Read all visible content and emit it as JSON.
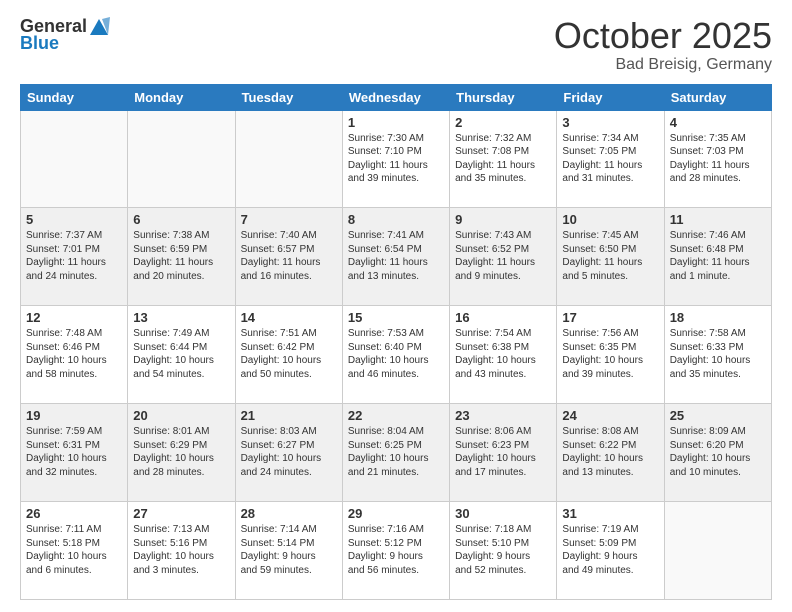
{
  "header": {
    "logo_general": "General",
    "logo_blue": "Blue",
    "month": "October 2025",
    "location": "Bad Breisig, Germany"
  },
  "days_of_week": [
    "Sunday",
    "Monday",
    "Tuesday",
    "Wednesday",
    "Thursday",
    "Friday",
    "Saturday"
  ],
  "weeks": [
    [
      {
        "day": "",
        "info": ""
      },
      {
        "day": "",
        "info": ""
      },
      {
        "day": "",
        "info": ""
      },
      {
        "day": "1",
        "info": "Sunrise: 7:30 AM\nSunset: 7:10 PM\nDaylight: 11 hours\nand 39 minutes."
      },
      {
        "day": "2",
        "info": "Sunrise: 7:32 AM\nSunset: 7:08 PM\nDaylight: 11 hours\nand 35 minutes."
      },
      {
        "day": "3",
        "info": "Sunrise: 7:34 AM\nSunset: 7:05 PM\nDaylight: 11 hours\nand 31 minutes."
      },
      {
        "day": "4",
        "info": "Sunrise: 7:35 AM\nSunset: 7:03 PM\nDaylight: 11 hours\nand 28 minutes."
      }
    ],
    [
      {
        "day": "5",
        "info": "Sunrise: 7:37 AM\nSunset: 7:01 PM\nDaylight: 11 hours\nand 24 minutes."
      },
      {
        "day": "6",
        "info": "Sunrise: 7:38 AM\nSunset: 6:59 PM\nDaylight: 11 hours\nand 20 minutes."
      },
      {
        "day": "7",
        "info": "Sunrise: 7:40 AM\nSunset: 6:57 PM\nDaylight: 11 hours\nand 16 minutes."
      },
      {
        "day": "8",
        "info": "Sunrise: 7:41 AM\nSunset: 6:54 PM\nDaylight: 11 hours\nand 13 minutes."
      },
      {
        "day": "9",
        "info": "Sunrise: 7:43 AM\nSunset: 6:52 PM\nDaylight: 11 hours\nand 9 minutes."
      },
      {
        "day": "10",
        "info": "Sunrise: 7:45 AM\nSunset: 6:50 PM\nDaylight: 11 hours\nand 5 minutes."
      },
      {
        "day": "11",
        "info": "Sunrise: 7:46 AM\nSunset: 6:48 PM\nDaylight: 11 hours\nand 1 minute."
      }
    ],
    [
      {
        "day": "12",
        "info": "Sunrise: 7:48 AM\nSunset: 6:46 PM\nDaylight: 10 hours\nand 58 minutes."
      },
      {
        "day": "13",
        "info": "Sunrise: 7:49 AM\nSunset: 6:44 PM\nDaylight: 10 hours\nand 54 minutes."
      },
      {
        "day": "14",
        "info": "Sunrise: 7:51 AM\nSunset: 6:42 PM\nDaylight: 10 hours\nand 50 minutes."
      },
      {
        "day": "15",
        "info": "Sunrise: 7:53 AM\nSunset: 6:40 PM\nDaylight: 10 hours\nand 46 minutes."
      },
      {
        "day": "16",
        "info": "Sunrise: 7:54 AM\nSunset: 6:38 PM\nDaylight: 10 hours\nand 43 minutes."
      },
      {
        "day": "17",
        "info": "Sunrise: 7:56 AM\nSunset: 6:35 PM\nDaylight: 10 hours\nand 39 minutes."
      },
      {
        "day": "18",
        "info": "Sunrise: 7:58 AM\nSunset: 6:33 PM\nDaylight: 10 hours\nand 35 minutes."
      }
    ],
    [
      {
        "day": "19",
        "info": "Sunrise: 7:59 AM\nSunset: 6:31 PM\nDaylight: 10 hours\nand 32 minutes."
      },
      {
        "day": "20",
        "info": "Sunrise: 8:01 AM\nSunset: 6:29 PM\nDaylight: 10 hours\nand 28 minutes."
      },
      {
        "day": "21",
        "info": "Sunrise: 8:03 AM\nSunset: 6:27 PM\nDaylight: 10 hours\nand 24 minutes."
      },
      {
        "day": "22",
        "info": "Sunrise: 8:04 AM\nSunset: 6:25 PM\nDaylight: 10 hours\nand 21 minutes."
      },
      {
        "day": "23",
        "info": "Sunrise: 8:06 AM\nSunset: 6:23 PM\nDaylight: 10 hours\nand 17 minutes."
      },
      {
        "day": "24",
        "info": "Sunrise: 8:08 AM\nSunset: 6:22 PM\nDaylight: 10 hours\nand 13 minutes."
      },
      {
        "day": "25",
        "info": "Sunrise: 8:09 AM\nSunset: 6:20 PM\nDaylight: 10 hours\nand 10 minutes."
      }
    ],
    [
      {
        "day": "26",
        "info": "Sunrise: 7:11 AM\nSunset: 5:18 PM\nDaylight: 10 hours\nand 6 minutes."
      },
      {
        "day": "27",
        "info": "Sunrise: 7:13 AM\nSunset: 5:16 PM\nDaylight: 10 hours\nand 3 minutes."
      },
      {
        "day": "28",
        "info": "Sunrise: 7:14 AM\nSunset: 5:14 PM\nDaylight: 9 hours\nand 59 minutes."
      },
      {
        "day": "29",
        "info": "Sunrise: 7:16 AM\nSunset: 5:12 PM\nDaylight: 9 hours\nand 56 minutes."
      },
      {
        "day": "30",
        "info": "Sunrise: 7:18 AM\nSunset: 5:10 PM\nDaylight: 9 hours\nand 52 minutes."
      },
      {
        "day": "31",
        "info": "Sunrise: 7:19 AM\nSunset: 5:09 PM\nDaylight: 9 hours\nand 49 minutes."
      },
      {
        "day": "",
        "info": ""
      }
    ]
  ]
}
